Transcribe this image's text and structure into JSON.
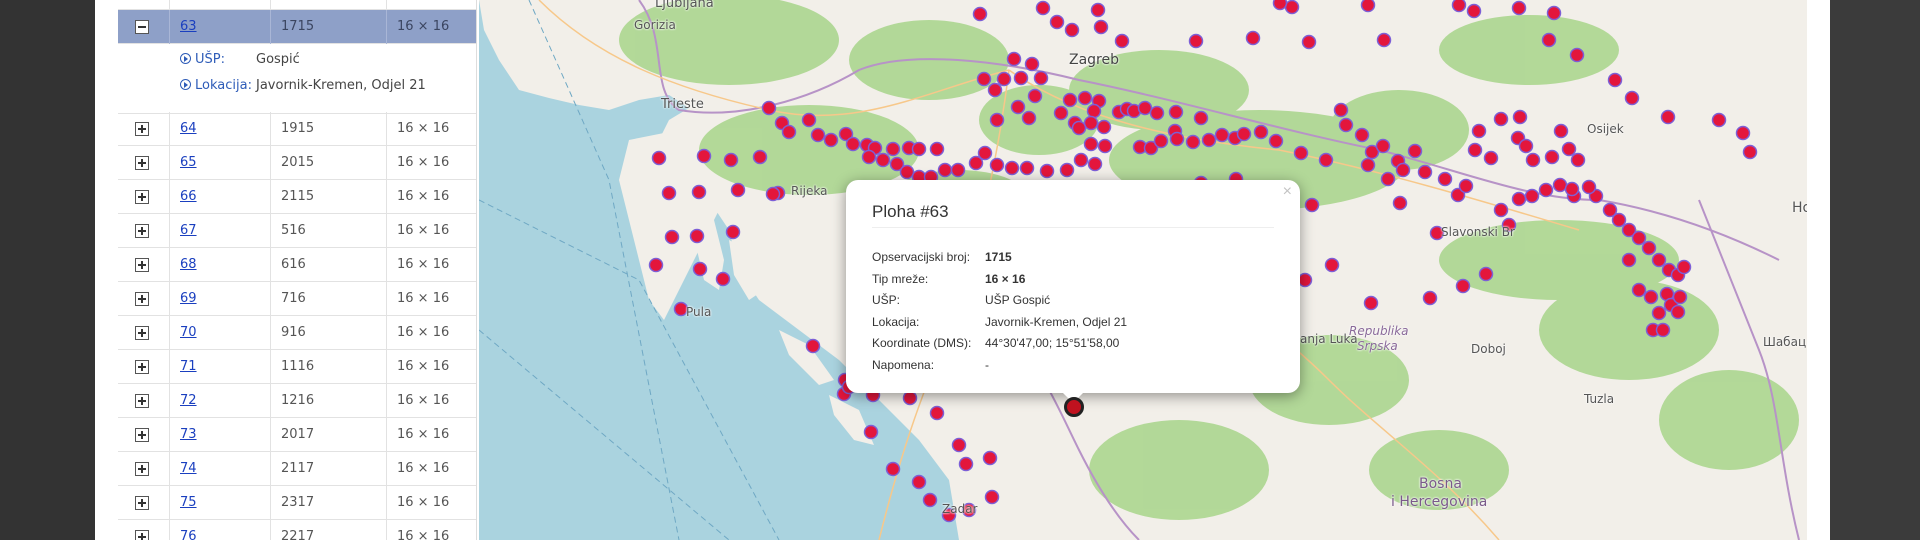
{
  "table": {
    "active_row": {
      "id": "63",
      "value": "1715",
      "grid": "16 × 16"
    },
    "detail": {
      "usp_label": "UŠP:",
      "usp_value": "Gospić",
      "location_label": "Lokacija:",
      "location_value": "Javornik-Kremen, Odjel 21"
    },
    "rows": [
      {
        "id": "64",
        "value": "1915",
        "grid": "16 × 16"
      },
      {
        "id": "65",
        "value": "2015",
        "grid": "16 × 16"
      },
      {
        "id": "66",
        "value": "2115",
        "grid": "16 × 16"
      },
      {
        "id": "67",
        "value": "516",
        "grid": "16 × 16"
      },
      {
        "id": "68",
        "value": "616",
        "grid": "16 × 16"
      },
      {
        "id": "69",
        "value": "716",
        "grid": "16 × 16"
      },
      {
        "id": "70",
        "value": "916",
        "grid": "16 × 16"
      },
      {
        "id": "71",
        "value": "1116",
        "grid": "16 × 16"
      },
      {
        "id": "72",
        "value": "1216",
        "grid": "16 × 16"
      },
      {
        "id": "73",
        "value": "2017",
        "grid": "16 × 16"
      },
      {
        "id": "74",
        "value": "2117",
        "grid": "16 × 16"
      },
      {
        "id": "75",
        "value": "2317",
        "grid": "16 × 16"
      },
      {
        "id": "76",
        "value": "2217",
        "grid": "16 × 16"
      }
    ]
  },
  "map": {
    "places": {
      "ljubljana": "Ljubljana",
      "gorizia": "Gorizia",
      "zagreb": "Zagreb",
      "trieste": "Trieste",
      "rijeka": "Rijeka",
      "pula": "Pula",
      "zadar": "Zadar",
      "osijek": "Osijek",
      "slavonski_brod": "Slavonski Br",
      "banja_luka": "anja Luka",
      "republika_srpska_1": "Republika",
      "republika_srpska_2": "Srpska",
      "doboj": "Doboj",
      "tuzla": "Tuzla",
      "bosna_1": "Bosna",
      "bosna_2": "i Hercegovina",
      "sabac": "Шабац",
      "ho": "Ho"
    },
    "colors": {
      "marker_fill": "#e3163c",
      "marker_stroke": "#7d5fd6",
      "forest": "#a8d58a",
      "sea": "#aad3df"
    }
  },
  "popup": {
    "close": "×",
    "title": "Ploha #63",
    "fields": [
      {
        "label": "Opservacijski broj:",
        "value": "1715",
        "bold": true
      },
      {
        "label": "Tip mreže:",
        "value": "16 × 16",
        "bold": true
      },
      {
        "label": "UŠP:",
        "value": "UŠP Gospić",
        "bold": false
      },
      {
        "label": "Lokacija:",
        "value": "Javornik-Kremen, Odjel 21",
        "bold": false
      },
      {
        "label": "Koordinate (DMS):",
        "value": "44°30'47,00; 15°51'58,00",
        "bold": false
      },
      {
        "label": "Napomena:",
        "value": "-",
        "bold": false
      }
    ]
  }
}
